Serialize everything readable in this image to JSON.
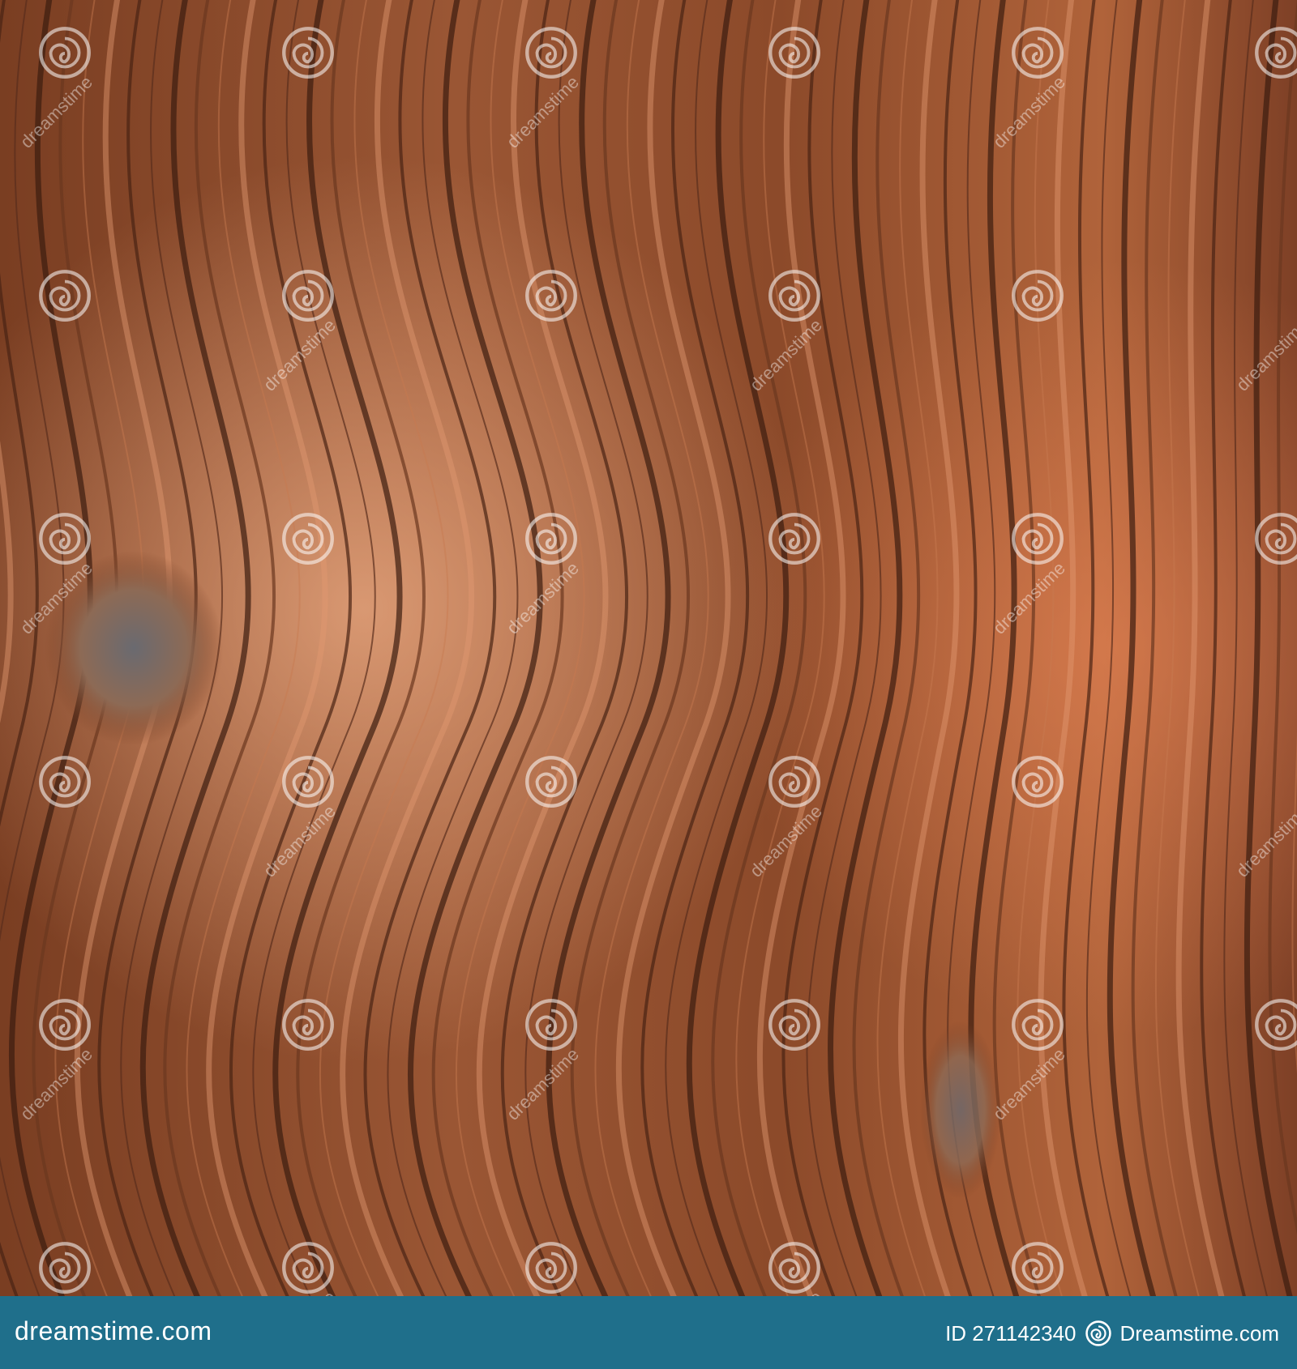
{
  "watermark": {
    "site_text": "dreamstime",
    "site_text_color": "#ffffff"
  },
  "footer": {
    "brand_left": "dreamstime.com",
    "image_id": "ID 271142340",
    "brand_right": "Dreamstime.com",
    "background_color": "#1f6f8b"
  },
  "photo": {
    "subject_colors": [
      "#8a4a2c",
      "#c2734a",
      "#e0956a",
      "#5a2e1c",
      "#a85c36"
    ]
  }
}
